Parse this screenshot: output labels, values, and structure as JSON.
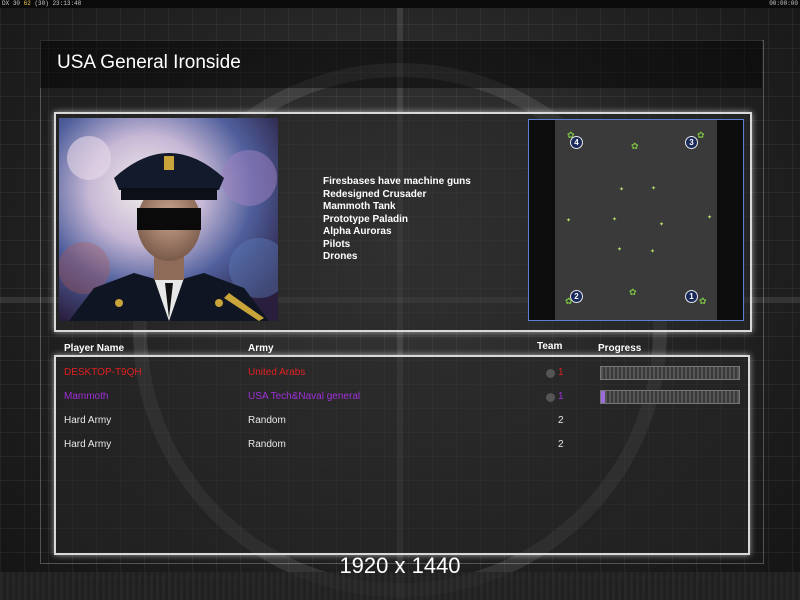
{
  "topbar": {
    "left_prefix": "DX",
    "left_fps": "30",
    "left_hl": "62",
    "left_mid": "(30)",
    "left_time": "23:13:48",
    "right_time": "00:00:00"
  },
  "title": "USA General Ironside",
  "portrait": {
    "alt": "general-portrait"
  },
  "features": [
    "Firesbases have machine guns",
    "Redesigned Crusader",
    "Mammoth Tank",
    "Prototype Paladin",
    "Alpha Auroras",
    "Pilots",
    "Drones"
  ],
  "minimap": {
    "spawns": [
      "4",
      "3",
      "2",
      "1"
    ],
    "border_color": "#5b7ed6"
  },
  "columns": {
    "player": "Player Name",
    "army": "Army",
    "team": "Team",
    "progress": "Progress"
  },
  "players": [
    {
      "name": "DESKTOP-T9QH",
      "army": "United Arabs",
      "team": "1",
      "color": "#e02020",
      "progress": 0.0
    },
    {
      "name": "Mammoth",
      "army": "USA Tech&Naval general",
      "team": "1",
      "color": "#a030d8",
      "progress": 0.03
    },
    {
      "name": "Hard Army",
      "army": "Random",
      "team": "2",
      "color": "#e8e8e8",
      "progress": null
    },
    {
      "name": "Hard Army",
      "army": "Random",
      "team": "2",
      "color": "#e8e8e8",
      "progress": null
    }
  ],
  "resolution": "1920 x 1440"
}
